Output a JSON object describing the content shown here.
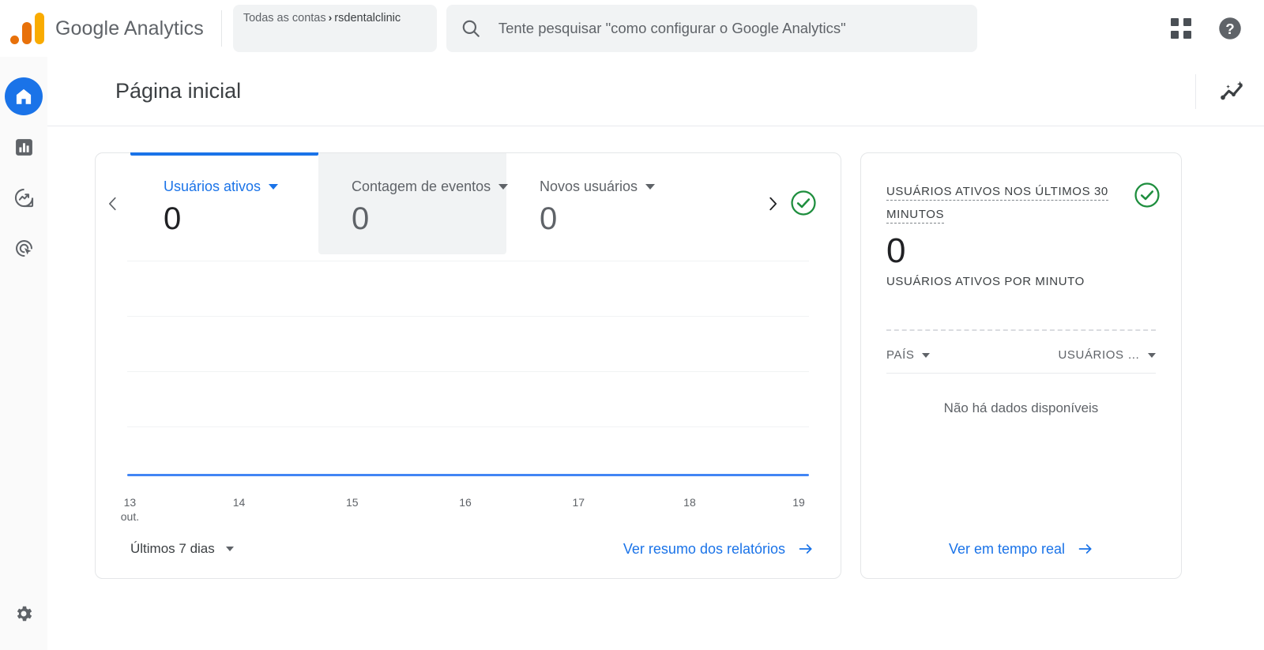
{
  "topbar": {
    "brand_name": "Google Analytics",
    "logo_icon": "google-analytics-logo",
    "account": {
      "parent": "Todas as contas",
      "separator": "›",
      "current": "rsdentalclinic"
    },
    "search": {
      "icon": "search-icon",
      "placeholder": "Tente pesquisar \"como configurar o Google Analytics\"",
      "value": ""
    },
    "apps_icon": "apps-grid-icon",
    "help_icon": "help-circle-icon"
  },
  "sidebar": {
    "items": [
      {
        "icon": "home-icon",
        "label": "Página inicial",
        "active": true
      },
      {
        "icon": "reports-bar-chart-icon",
        "label": "Relatórios",
        "active": false
      },
      {
        "icon": "explore-trend-icon",
        "label": "Explorar",
        "active": false
      },
      {
        "icon": "advertising-target-icon",
        "label": "Publicidade",
        "active": false
      }
    ],
    "bottom": {
      "icon": "gear-icon",
      "label": "Administrador"
    }
  },
  "page": {
    "title": "Página inicial",
    "insights_icon": "insights-sparkle-icon"
  },
  "main_card": {
    "prev_icon": "chevron-left-icon",
    "next_icon": "chevron-right-icon",
    "status_icon": "check-circle-icon",
    "status_color": "#1e8e3e",
    "accent_color": "#1a73e8",
    "metrics": [
      {
        "label": "Usuários ativos",
        "value": "0",
        "active": true,
        "hovered": false
      },
      {
        "label": "Contagem de eventos",
        "value": "0",
        "active": false,
        "hovered": true
      },
      {
        "label": "Novos usuários",
        "value": "0",
        "active": false,
        "hovered": false
      }
    ],
    "date_range": "Últimos 7 dias",
    "footer_link": "Ver resumo dos relatórios",
    "footer_link_icon": "arrow-right-icon"
  },
  "chart_data": {
    "type": "line",
    "title": "Usuários ativos",
    "xlabel": "",
    "ylabel": "",
    "x": [
      "13",
      "14",
      "15",
      "16",
      "17",
      "18",
      "19"
    ],
    "x_unit": "out.",
    "series": [
      {
        "name": "Usuários ativos",
        "values": [
          0,
          0,
          0,
          0,
          0,
          0,
          0
        ],
        "color": "#4285f4"
      }
    ],
    "ylim": [
      0,
      1
    ],
    "grid": true,
    "gridlines": 4,
    "legend": "none"
  },
  "realtime_card": {
    "title": "USUÁRIOS ATIVOS NOS ÚLTIMOS 30 MINUTOS",
    "title_line1": "USUÁRIOS ATIVOS NOS ÚLTIMOS 30",
    "title_line2": "MINUTOS",
    "value": "0",
    "subtitle": "USUÁRIOS ATIVOS POR MINUTO",
    "status_icon": "check-circle-icon",
    "status_color": "#1e8e3e",
    "table": {
      "columns": [
        "PAÍS",
        "USUÁRIOS …"
      ],
      "rows": [],
      "empty_message": "Não há dados disponíveis"
    },
    "footer_link": "Ver em tempo real",
    "footer_link_icon": "arrow-right-icon"
  }
}
